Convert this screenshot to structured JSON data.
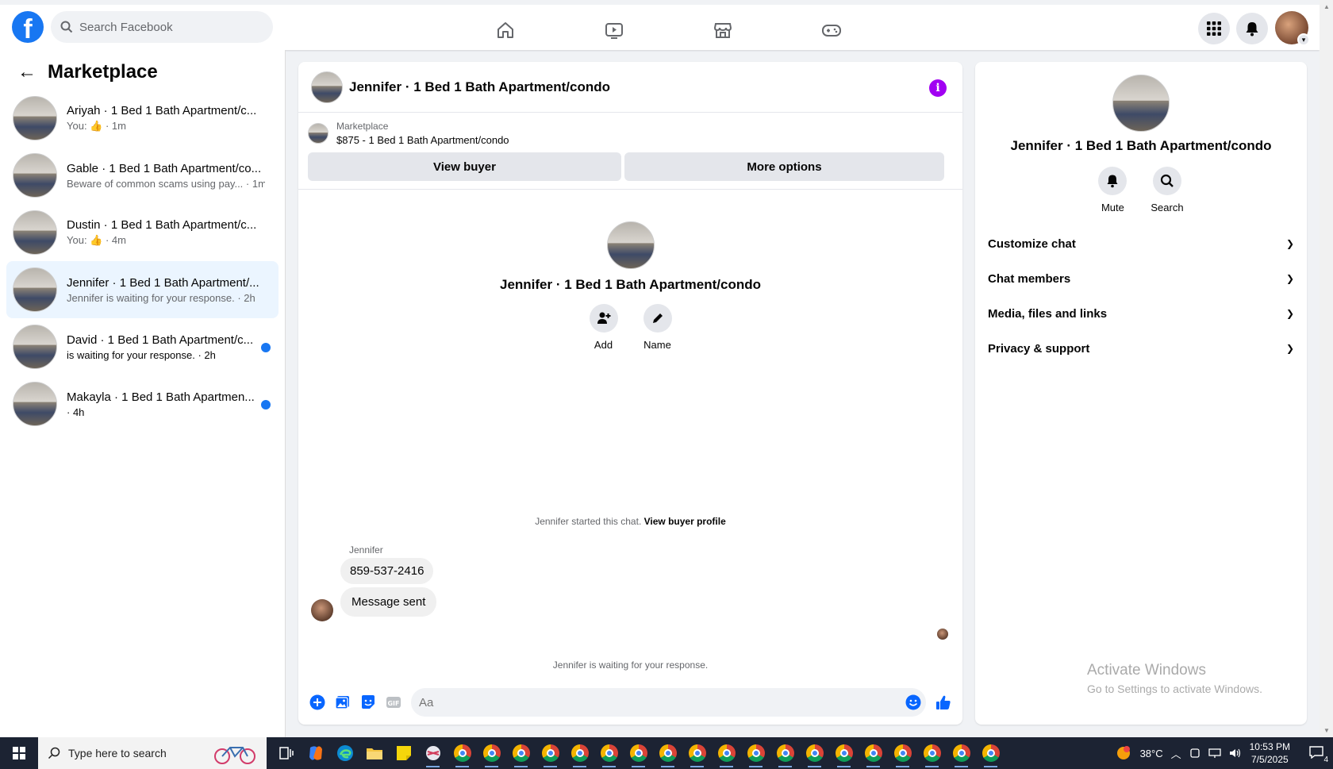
{
  "topbar": {
    "logo": "f",
    "search_placeholder": "Search Facebook",
    "nav_icons": [
      "home-icon",
      "video-icon",
      "marketplace-icon",
      "gaming-icon"
    ],
    "right_icons": [
      "menu-grid-icon",
      "bell-icon"
    ]
  },
  "sidebar": {
    "title": "Marketplace",
    "conversations": [
      {
        "name": "Ariyah · 1 Bed 1 Bath Apartment/c...",
        "sub": "You: 👍 · 1m",
        "unread": false
      },
      {
        "name": "Gable · 1 Bed 1 Bath Apartment/co...",
        "sub": "Beware of common scams using pay... · 1m",
        "unread": false
      },
      {
        "name": "Dustin · 1 Bed 1 Bath Apartment/c...",
        "sub": "You: 👍 · 4m",
        "unread": false
      },
      {
        "name": "Jennifer · 1 Bed 1 Bath Apartment/...",
        "sub": "Jennifer is waiting for your response. · 2h",
        "unread": false
      },
      {
        "name": "David · 1 Bed 1 Bath Apartment/c...",
        "sub": "is waiting for your response. · 2h",
        "unread": true
      },
      {
        "name": "Makayla · 1 Bed 1 Bath Apartmen...",
        "sub": "· 4h",
        "unread": true
      }
    ]
  },
  "chat": {
    "title": "Jennifer · 1 Bed 1 Bath Apartment/condo",
    "listing_label": "Marketplace",
    "listing_price": "$875 - 1 Bed 1 Bath Apartment/condo",
    "view_buyer": "View buyer",
    "more_options": "More options",
    "intro_title": "Jennifer · 1 Bed 1 Bath Apartment/condo",
    "add_label": "Add",
    "name_label": "Name",
    "started_text": "Jennifer started this chat.",
    "view_profile": "View buyer profile",
    "sender": "Jennifer",
    "messages": [
      "859-537-2416",
      "Message sent"
    ],
    "waiting_text": "Jennifer is waiting for your response.",
    "input_placeholder": "Aa"
  },
  "details": {
    "title": "Jennifer · 1 Bed 1 Bath Apartment/condo",
    "mute_label": "Mute",
    "search_label": "Search",
    "sections": [
      "Customize chat",
      "Chat members",
      "Media, files and links",
      "Privacy & support"
    ],
    "activate_title": "Activate Windows",
    "activate_sub": "Go to Settings to activate Windows."
  },
  "taskbar": {
    "search_placeholder": "Type here to search",
    "temperature": "38°C",
    "time": "10:53 PM",
    "date": "7/5/2025",
    "notification_count": "4"
  },
  "colors": {
    "brand": "#1877f2",
    "info": "#a100f2",
    "active_row": "#ebf5ff",
    "taskbar": "#1c2333"
  }
}
